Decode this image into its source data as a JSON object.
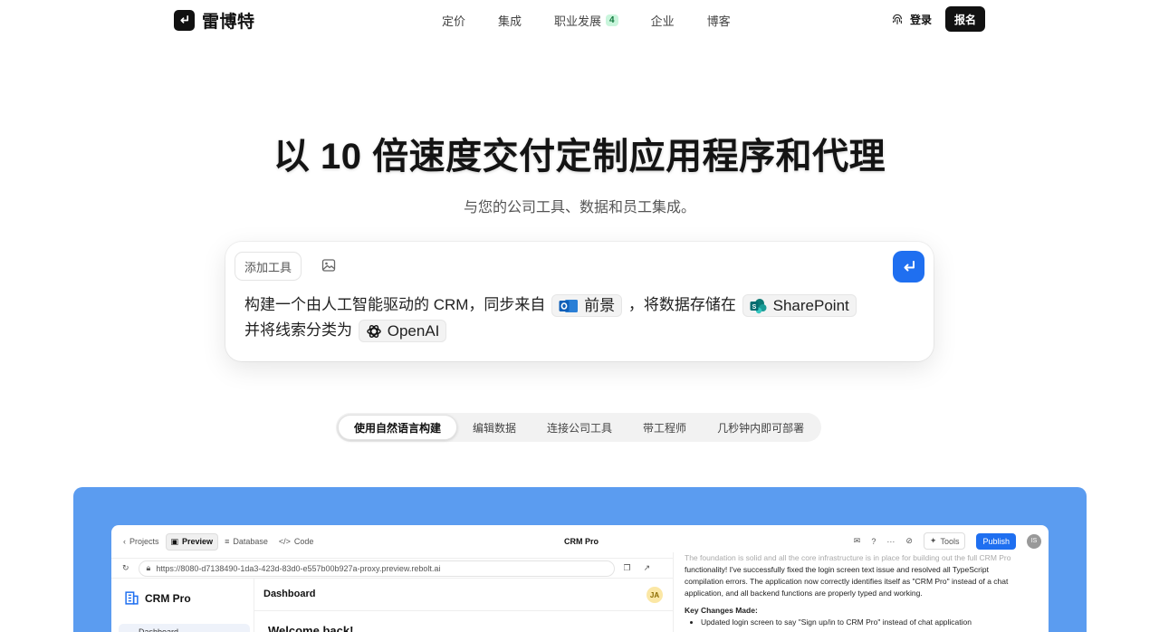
{
  "nav": {
    "brand": "雷博特",
    "links": [
      {
        "label": "定价"
      },
      {
        "label": "集成"
      },
      {
        "label": "职业发展",
        "badge": "4"
      },
      {
        "label": "企业"
      },
      {
        "label": "博客"
      }
    ],
    "login": "登录",
    "signup": "报名"
  },
  "hero": {
    "title": "以 10 倍速度交付定制应用程序和代理",
    "subtitle": "与您的公司工具、数据和员工集成。"
  },
  "prompt": {
    "add_tools": "添加工具",
    "part1": "构建一个由人工智能驱动的 CRM，同步来自",
    "chip_outlook": "前景",
    "part2": "，将数据存储在",
    "chip_sharepoint": "SharePoint",
    "part3": "并将线索分类为",
    "chip_openai": "OpenAI"
  },
  "tabs": [
    {
      "label": "使用自然语言构建",
      "active": true
    },
    {
      "label": "编辑数据",
      "active": false
    },
    {
      "label": "连接公司工具",
      "active": false
    },
    {
      "label": "带工程师",
      "active": false
    },
    {
      "label": "几秒钟内即可部署",
      "active": false
    }
  ],
  "app": {
    "projects": "Projects",
    "preview": "Preview",
    "database": "Database",
    "code": "Code",
    "title": "CRM Pro",
    "more": "···",
    "tools": "Tools",
    "publish": "Publish",
    "avatar": "IS",
    "url": "https://8080-d7138490-1da3-423d-83d0-e557b00b927a-proxy.preview.rebolt.ai",
    "crm_name": "CRM Pro",
    "dashboard_nav": "Dashboard",
    "dashboard_title": "Dashboard",
    "ja": "JA",
    "welcome": "Welcome back!",
    "chat_faded": "The foundation is solid and all the core infrastructure is in place for building out the full CRM Pro",
    "chat_line1": "functionality! I've successfully fixed the login screen text issue and resolved all TypeScript",
    "chat_line2": "compilation errors. The application now correctly identifies itself as \"CRM Pro\" instead of a chat",
    "chat_line3": "application, and all backend functions are properly typed and working.",
    "chat_heading": "Key Changes Made:",
    "chat_bullet": "Updated login screen to say \"Sign up/in to CRM Pro\" instead of chat application"
  },
  "colors": {
    "accent": "#1f6ff0",
    "showcase": "#5b9cf0",
    "badge_bg": "#c9f5dc"
  }
}
